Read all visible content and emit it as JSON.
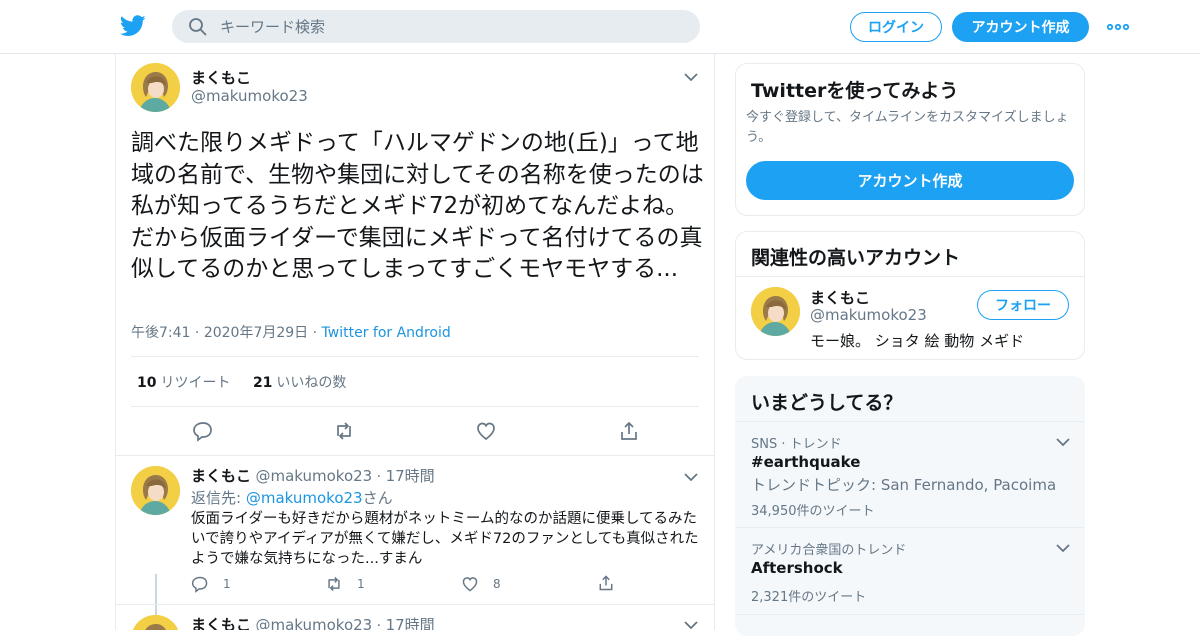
{
  "header": {
    "search_placeholder": "キーワード検索",
    "login_label": "ログイン",
    "signup_label": "アカウント作成"
  },
  "tweet": {
    "name": "まくもこ",
    "handle": "@makumoko23",
    "text": "調べた限りメギドって「ハルマゲドンの地(丘)」って地域の名前で、生物や集団に対してその名称を使ったのは私が知ってるうちだとメギド72が初めてなんだよね。だから仮面ライダーで集団にメギドって名付けてるの真似してるのかと思ってしまってすごくモヤモヤする...",
    "time": "午後7:41",
    "date": "2020年7月29日",
    "source": "Twitter for Android",
    "retweet_count": "10",
    "retweet_label": "リツイート",
    "like_count": "21",
    "like_label": "いいねの数"
  },
  "reply": {
    "name": "まくもこ",
    "handle": "@makumoko23",
    "time": "17時間",
    "reply_to_prefix": "返信先:",
    "reply_to_handle": "@makumoko23",
    "reply_to_suffix": "さん",
    "text": "仮面ライダーも好きだから題材がネットミーム的なのか話題に便乗してるみたいで誇りやアイディアが無くて嫌だし、メギド72のファンとしても真似されたようで嫌な気持ちになった...すまん",
    "reply_count": "1",
    "retweet_count": "1",
    "like_count": "8"
  },
  "reply2": {
    "name": "まくもこ",
    "handle": "@makumoko23",
    "time": "17時間"
  },
  "signup_card": {
    "title": "Twitterを使ってみよう",
    "desc": "今すぐ登録して、タイムラインをカスタマイズしましょう。",
    "button": "アカウント作成"
  },
  "related_card": {
    "title": "関連性の高いアカウント",
    "name": "まくもこ",
    "handle": "@makumoko23",
    "bio": "モー娘。 ショタ 絵 動物 メギド",
    "follow": "フォロー"
  },
  "trends": {
    "title": "いまどうしてる？",
    "items": [
      {
        "context": "SNS · トレンド",
        "name": "#earthquake",
        "topics": "トレンドトピック: San Fernando, Pacoima",
        "count": "34,950件のツイート"
      },
      {
        "context": "アメリカ合衆国のトレンド",
        "name": "Aftershock",
        "count": "2,321件のツイート"
      }
    ]
  },
  "colors": {
    "accent": "#1da1f2",
    "link": "#1b95e0",
    "muted": "#657786",
    "text": "#14171a"
  },
  "icons": [
    "twitter-bird-icon",
    "search-icon",
    "more-dots-icon",
    "chevron-down-icon",
    "reply-icon",
    "retweet-icon",
    "like-icon",
    "share-icon"
  ]
}
